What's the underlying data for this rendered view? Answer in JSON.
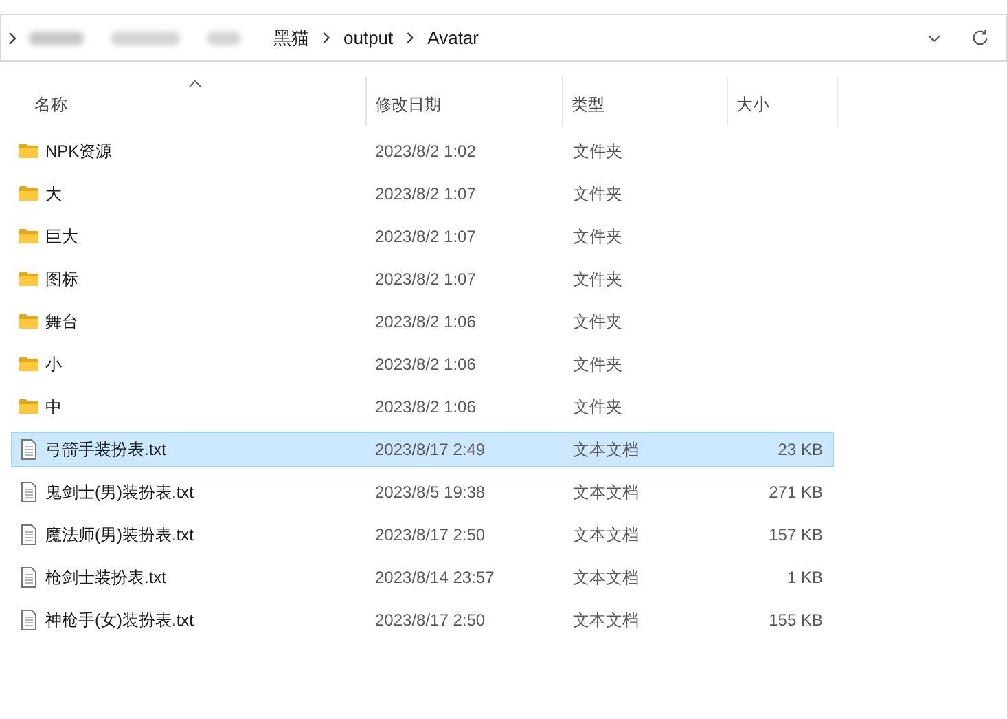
{
  "address_bar": {
    "path": [
      "黑猫",
      "output",
      "Avatar"
    ]
  },
  "columns": [
    {
      "label": "名称",
      "sorted": true
    },
    {
      "label": "修改日期",
      "sorted": false
    },
    {
      "label": "类型",
      "sorted": false
    },
    {
      "label": "大小",
      "sorted": false
    }
  ],
  "rows": [
    {
      "kind": "folder",
      "name": "NPK资源",
      "date": "2023/8/2 1:02",
      "type": "文件夹",
      "size": "",
      "selected": false
    },
    {
      "kind": "folder",
      "name": "大",
      "date": "2023/8/2 1:07",
      "type": "文件夹",
      "size": "",
      "selected": false
    },
    {
      "kind": "folder",
      "name": "巨大",
      "date": "2023/8/2 1:07",
      "type": "文件夹",
      "size": "",
      "selected": false
    },
    {
      "kind": "folder",
      "name": "图标",
      "date": "2023/8/2 1:07",
      "type": "文件夹",
      "size": "",
      "selected": false
    },
    {
      "kind": "folder",
      "name": "舞台",
      "date": "2023/8/2 1:06",
      "type": "文件夹",
      "size": "",
      "selected": false
    },
    {
      "kind": "folder",
      "name": "小",
      "date": "2023/8/2 1:06",
      "type": "文件夹",
      "size": "",
      "selected": false
    },
    {
      "kind": "folder",
      "name": "中",
      "date": "2023/8/2 1:06",
      "type": "文件夹",
      "size": "",
      "selected": false
    },
    {
      "kind": "file",
      "name": "弓箭手装扮表.txt",
      "date": "2023/8/17 2:49",
      "type": "文本文档",
      "size": "23 KB",
      "selected": true
    },
    {
      "kind": "file",
      "name": "鬼剑士(男)装扮表.txt",
      "date": "2023/8/5 19:38",
      "type": "文本文档",
      "size": "271 KB",
      "selected": false
    },
    {
      "kind": "file",
      "name": "魔法师(男)装扮表.txt",
      "date": "2023/8/17 2:50",
      "type": "文本文档",
      "size": "157 KB",
      "selected": false
    },
    {
      "kind": "file",
      "name": "枪剑士装扮表.txt",
      "date": "2023/8/14 23:57",
      "type": "文本文档",
      "size": "1 KB",
      "selected": false
    },
    {
      "kind": "file",
      "name": "神枪手(女)装扮表.txt",
      "date": "2023/8/17 2:50",
      "type": "文本文档",
      "size": "155 KB",
      "selected": false
    }
  ]
}
